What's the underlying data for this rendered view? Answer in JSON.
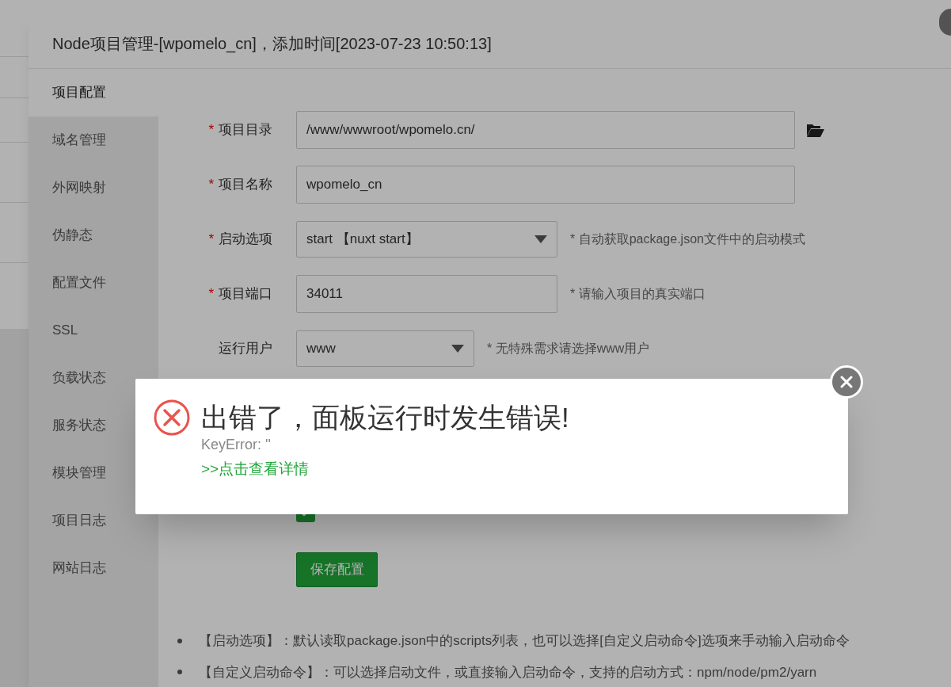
{
  "modal": {
    "title": "Node项目管理-[wpomelo_cn]，添加时间[2023-07-23 10:50:13]",
    "sidebar": [
      {
        "label": "项目配置",
        "selected": true
      },
      {
        "label": "域名管理",
        "selected": false
      },
      {
        "label": "外网映射",
        "selected": false
      },
      {
        "label": "伪静态",
        "selected": false
      },
      {
        "label": "配置文件",
        "selected": false
      },
      {
        "label": "SSL",
        "selected": false
      },
      {
        "label": "负载状态",
        "selected": false
      },
      {
        "label": "服务状态",
        "selected": false
      },
      {
        "label": "模块管理",
        "selected": false
      },
      {
        "label": "项目日志",
        "selected": false
      },
      {
        "label": "网站日志",
        "selected": false
      }
    ],
    "form": [
      {
        "kind": "path",
        "required_mark": "*",
        "label": "项目目录",
        "value": "/www/wwwroot/wpomelo.cn/"
      },
      {
        "kind": "text",
        "required_mark": "*",
        "label": "项目名称",
        "value": "wpomelo_cn"
      },
      {
        "kind": "select",
        "required_mark": "*",
        "label": "启动选项",
        "value": "start 【nuxt start】",
        "hint": "* 自动获取package.json文件中的启动模式"
      },
      {
        "kind": "text",
        "required_mark": "*",
        "label": "项目端口",
        "value": "34011",
        "hint": "* 请输入项目的真实端口"
      },
      {
        "kind": "select",
        "label": "运行用户",
        "value": "www",
        "hint": "* 无特殊需求请选择www用户"
      },
      {
        "kind": "checkbox",
        "checked": true
      }
    ],
    "save_button": "保存配置",
    "notes": [
      "【启动选项】：默认读取package.json中的scripts列表，也可以选择[自定义启动命令]选项来手动输入启动命令",
      "【自定义启动命令】：可以选择启动文件，或直接输入启动命令，支持的启动方式：npm/node/pm2/yarn"
    ]
  },
  "error_dialog": {
    "title": "出错了，面板运行时发生错误!",
    "message": "KeyError: ''",
    "link": ">>点击查看详情"
  }
}
